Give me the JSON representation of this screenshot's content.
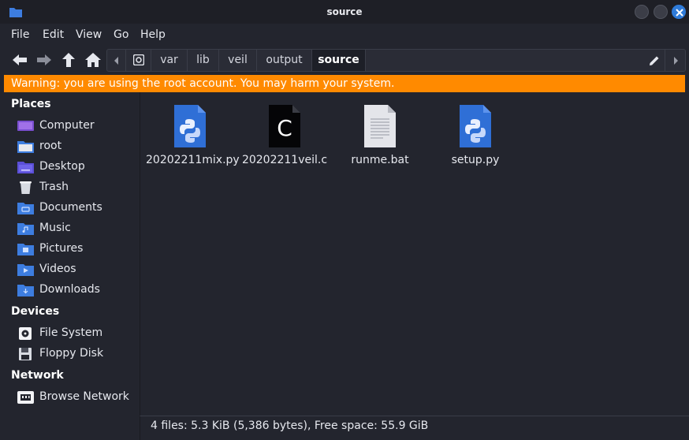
{
  "window": {
    "title": "source",
    "app_icon": "folder-icon"
  },
  "menu": {
    "file": "File",
    "edit": "Edit",
    "view": "View",
    "go": "Go",
    "help": "Help"
  },
  "toolbar": {
    "back_icon": "arrow-left-icon",
    "forward_icon": "arrow-right-icon",
    "up_icon": "arrow-up-icon",
    "home_icon": "home-icon",
    "edit_location_icon": "pencil-icon"
  },
  "path": {
    "segments": [
      "var",
      "lib",
      "veil",
      "output",
      "source"
    ],
    "current": "source"
  },
  "warning": {
    "text": "Warning: you are using the root account. You may harm your system.",
    "color": "#ff8a00"
  },
  "sidebar": {
    "places_heading": "Places",
    "places": [
      {
        "label": "Computer",
        "icon": "computer-icon"
      },
      {
        "label": "root",
        "icon": "home-folder-icon"
      },
      {
        "label": "Desktop",
        "icon": "desktop-folder-icon"
      },
      {
        "label": "Trash",
        "icon": "trash-icon"
      },
      {
        "label": "Documents",
        "icon": "documents-folder-icon"
      },
      {
        "label": "Music",
        "icon": "music-folder-icon"
      },
      {
        "label": "Pictures",
        "icon": "pictures-folder-icon"
      },
      {
        "label": "Videos",
        "icon": "videos-folder-icon"
      },
      {
        "label": "Downloads",
        "icon": "downloads-folder-icon"
      }
    ],
    "devices_heading": "Devices",
    "devices": [
      {
        "label": "File System",
        "icon": "drive-icon"
      },
      {
        "label": "Floppy Disk",
        "icon": "floppy-icon"
      }
    ],
    "network_heading": "Network",
    "network": [
      {
        "label": "Browse Network",
        "icon": "network-icon"
      }
    ]
  },
  "files": [
    {
      "name": "20202211mix.py",
      "icon": "python-file-icon"
    },
    {
      "name": "20202211veil.c",
      "icon": "c-file-icon"
    },
    {
      "name": "runme.bat",
      "icon": "text-file-icon"
    },
    {
      "name": "setup.py",
      "icon": "python-file-icon"
    }
  ],
  "status": {
    "text": "4 files: 5.3 KiB (5,386 bytes), Free space: 55.9 GiB"
  },
  "colors": {
    "accent": "#2f7bd9",
    "background": "#23252e",
    "folder": "#3d7de0"
  }
}
